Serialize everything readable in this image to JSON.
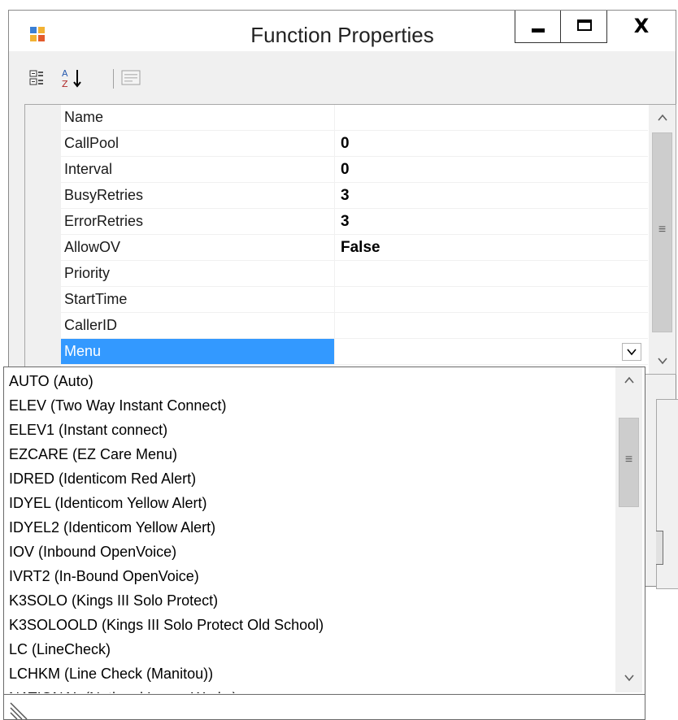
{
  "window": {
    "title": "Function Properties",
    "controls": {
      "minimize": "—",
      "maximize": "☐",
      "close": "X"
    }
  },
  "toolbar": {
    "categorized_icon": "categorized-icon",
    "alphabetical_icon": "alphabetical-sort-icon",
    "property_pages_icon": "property-pages-icon"
  },
  "properties": [
    {
      "name": "Name",
      "value": ""
    },
    {
      "name": "CallPool",
      "value": "0"
    },
    {
      "name": "Interval",
      "value": "0"
    },
    {
      "name": "BusyRetries",
      "value": "3"
    },
    {
      "name": "ErrorRetries",
      "value": "3"
    },
    {
      "name": "AllowOV",
      "value": "False"
    },
    {
      "name": "Priority",
      "value": ""
    },
    {
      "name": "StartTime",
      "value": ""
    },
    {
      "name": "CallerID",
      "value": ""
    },
    {
      "name": "Menu",
      "value": ""
    }
  ],
  "selected_property": "Menu",
  "dropdown": {
    "button": "⌄",
    "items": [
      "AUTO (Auto)",
      "ELEV (Two Way Instant Connect)",
      "ELEV1 (Instant connect)",
      "EZCARE (EZ Care Menu)",
      "IDRED (Identicom Red Alert)",
      "IDYEL (Identicom Yellow Alert)",
      "IDYEL2 (Identicom Yellow Alert)",
      "IOV (Inbound OpenVoice)",
      "IVRT2 (In-Bound OpenVoice)",
      "K3SOLO (Kings III Solo Protect)",
      "K3SOLOOLD (Kings III Solo Protect Old School)",
      "LC (LineCheck)",
      "LCHKM (Line Check (Manitou))",
      "NATIONAL (National Lease Works)"
    ]
  },
  "scrollbars": {
    "up": "^",
    "down": "v",
    "grip": "≡"
  },
  "colors": {
    "selection": "#3399ff",
    "panel": "#f0f0f0"
  }
}
